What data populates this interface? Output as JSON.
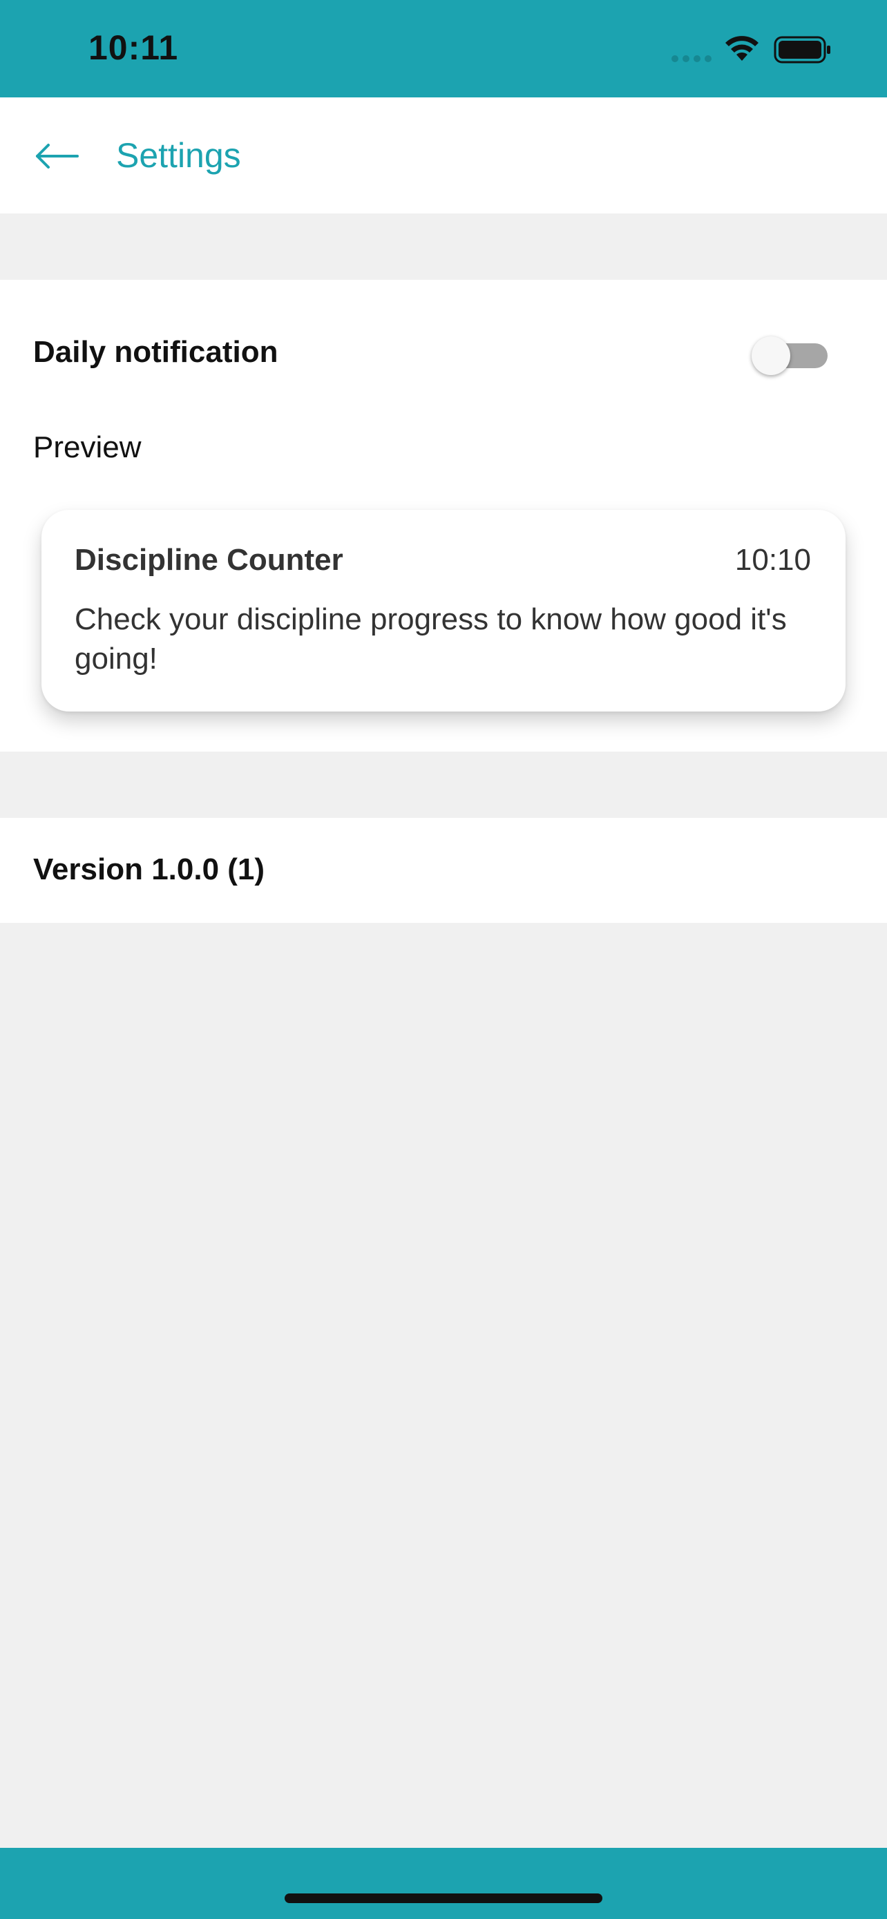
{
  "status_bar": {
    "time": "10:11",
    "background_color": "#1ca3b0",
    "icons": [
      "signal-dots-icon",
      "wifi-icon",
      "battery-icon"
    ]
  },
  "app_bar": {
    "back_icon": "arrow-left-icon",
    "title": "Settings",
    "accent_color": "#1ca3b0"
  },
  "notification": {
    "label": "Daily notification",
    "toggle_on": false,
    "preview_label": "Preview",
    "preview_card": {
      "title": "Discipline Counter",
      "time": "10:10",
      "body": "Check your discipline progress to know how good it's going!"
    }
  },
  "version": {
    "label": "Version 1.0.0 (1)"
  }
}
